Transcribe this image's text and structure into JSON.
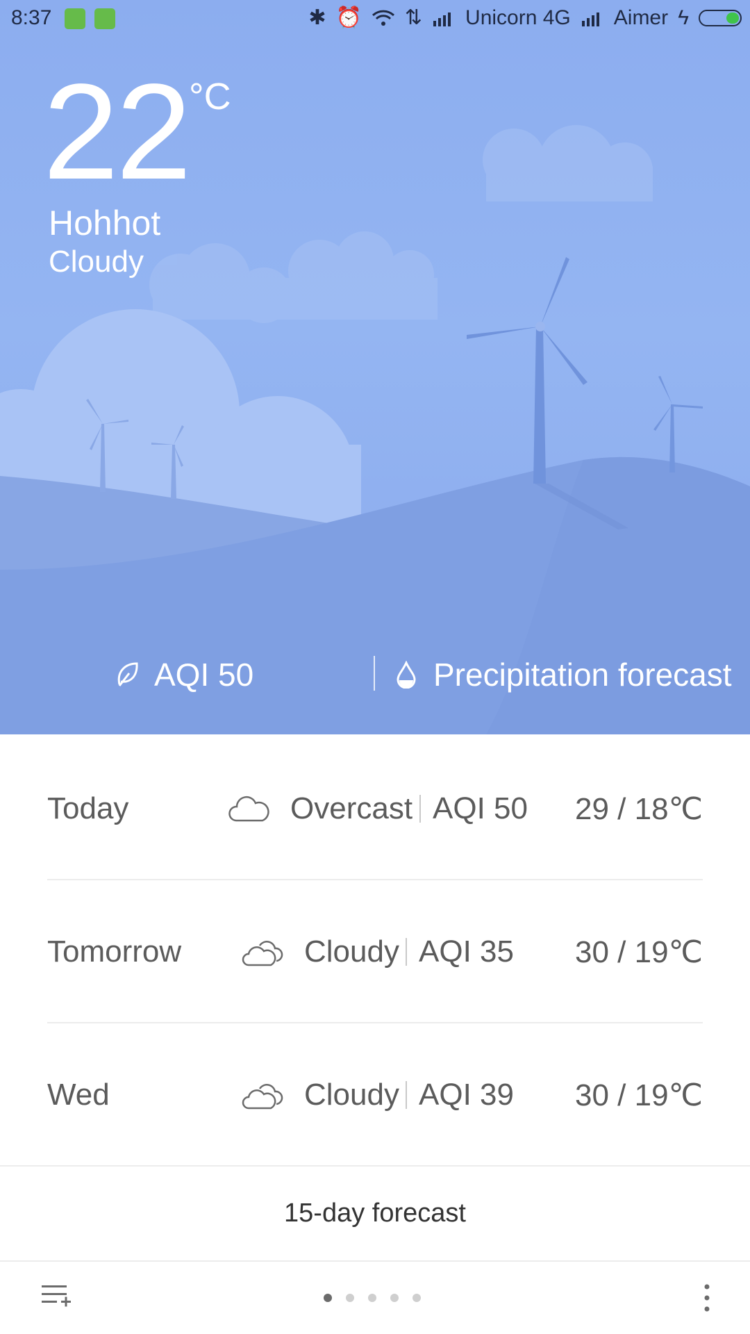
{
  "status_bar": {
    "time": "8:37",
    "carrier1": "Unicorn 4G",
    "carrier2": "Aimer",
    "icons": [
      "bluetooth-icon",
      "alarm-icon",
      "wifi-icon",
      "data-arrows-icon",
      "signal-icon",
      "charging-icon",
      "battery-icon"
    ]
  },
  "current": {
    "temperature": "22",
    "unit": "°C",
    "city": "Hohhot",
    "condition": "Cloudy"
  },
  "hero_links": {
    "aqi": "AQI 50",
    "precipitation": "Precipitation forecast"
  },
  "forecast": [
    {
      "day": "Today",
      "icon": "overcast-cloud-icon",
      "desc": "Overcast",
      "aqi": "AQI 50",
      "range": "29 / 18℃"
    },
    {
      "day": "Tomorrow",
      "icon": "cloudy-icon",
      "desc": "Cloudy",
      "aqi": "AQI 35",
      "range": "30 / 19℃"
    },
    {
      "day": "Wed",
      "icon": "cloudy-icon",
      "desc": "Cloudy",
      "aqi": "AQI 39",
      "range": "30 / 19℃"
    }
  ],
  "fifteen_day": "15-day forecast",
  "pager": {
    "count": 5,
    "active": 1
  },
  "colors": {
    "sky_top": "#8cadef",
    "sky_bottom": "#8aa9ec",
    "battery": "#3fc44a",
    "badge": "#66bb4a"
  }
}
